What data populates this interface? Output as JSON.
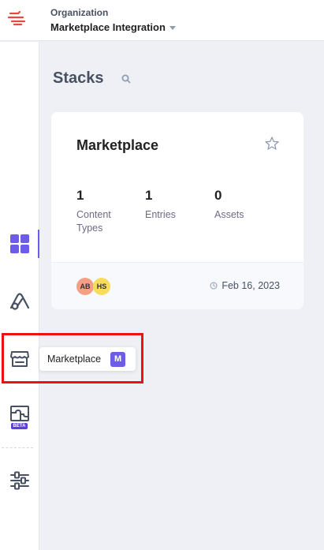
{
  "org": {
    "label": "Organization",
    "name": "Marketplace Integration"
  },
  "page": {
    "title": "Stacks"
  },
  "sidebar": {
    "items": [
      {
        "name": "dashboard",
        "icon": "grid-icon",
        "active": true
      },
      {
        "name": "automations",
        "icon": "automate-icon"
      },
      {
        "name": "marketplace",
        "icon": "store-icon"
      },
      {
        "name": "apps-beta",
        "icon": "puzzle-icon",
        "badge": "BETA"
      },
      {
        "name": "settings",
        "icon": "sliders-icon"
      }
    ]
  },
  "tooltip": {
    "label": "Marketplace",
    "shortcut": "M"
  },
  "stack_card": {
    "name": "Marketplace",
    "stats": [
      {
        "value": "1",
        "label": "Content Types"
      },
      {
        "value": "1",
        "label": "Entries"
      },
      {
        "value": "0",
        "label": "Assets"
      }
    ],
    "avatars": [
      {
        "initials": "AB",
        "color": "#f59f84"
      },
      {
        "initials": "HS",
        "color": "#f8dc5c"
      }
    ],
    "date": "Feb 16, 2023"
  },
  "colors": {
    "accent": "#6c5ce7",
    "brand": "#e8483e",
    "highlight": "#ee1111"
  }
}
